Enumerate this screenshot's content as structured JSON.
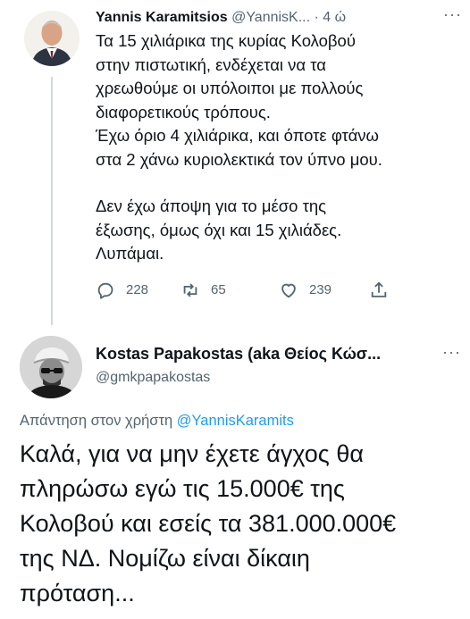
{
  "tweet1": {
    "author_name": "Yannis Karamitsios",
    "author_handle": "@YannisK...",
    "separator": "·",
    "time": "4 ώ",
    "more_label": "···",
    "paragraph1": "Τα 15 χιλιάρικα της κυρίας Κολοβού\nστην πιστωτική, ενδέχεται να τα\nχρεωθούμε οι υπόλοιποι με πολλούς\nδιαφορετικούς τρόπους.\nΈχω όριο 4 χιλιάρικα, και όποτε φτάνω\nστα 2 χάνω κυριολεκτικά τον ύπνο μου.",
    "paragraph2": "Δεν έχω άποψη για το μέσο της\nέξωσης, όμως όχι και 15 χιλιάδες.\nΛυπάμαι.",
    "actions": {
      "reply_icon": "reply-icon",
      "reply_count": "228",
      "retweet_icon": "retweet-icon",
      "retweet_count": "65",
      "like_icon": "heart-icon",
      "like_count": "239",
      "share_icon": "share-icon"
    }
  },
  "tweet2": {
    "author_name": "Kostas Papakostas (aka Θείος Κώσ...",
    "author_handle": "@gmkpapakostas",
    "more_label": "···",
    "reply_prefix": "Απάντηση στον χρήστη",
    "reply_mention": "@YannisKaramits",
    "body": "Καλά, για να μην έχετε άγχος θα\nπληρώσω εγώ τις 15.000€ της\nΚολοβού και εσείς τα 381.000.000€\nτης ΝΔ. Νομίζω είναι δίκαιη\nπρόταση..."
  },
  "colors": {
    "text": "#0f1419",
    "secondary": "#536471",
    "link": "#1d9bf0",
    "thread_line": "#cfd9de"
  }
}
